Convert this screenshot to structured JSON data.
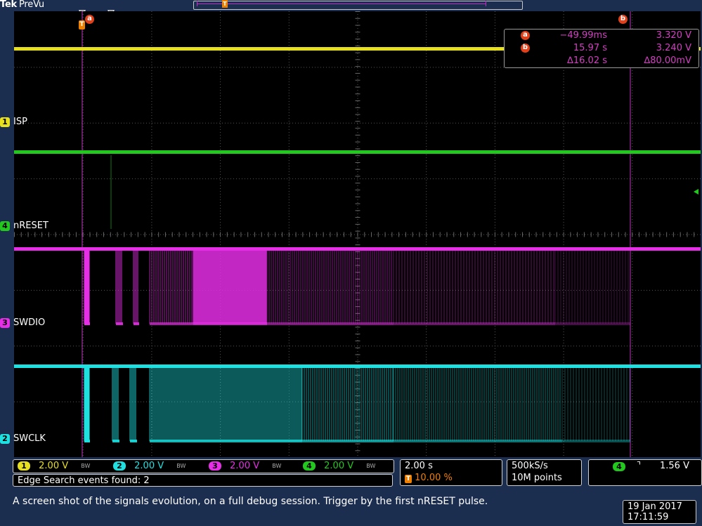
{
  "header": {
    "brand": "Tek",
    "mode": "PreVu"
  },
  "channels": [
    {
      "id": "1",
      "name": "ISP",
      "color": "#e6e01e"
    },
    {
      "id": "4",
      "name": "nRESET",
      "color": "#22c81e"
    },
    {
      "id": "3",
      "name": "SWDIO",
      "color": "#e62ee6"
    },
    {
      "id": "2",
      "name": "SWCLK",
      "color": "#1ee0e0"
    }
  ],
  "cursors": {
    "a_label": "a",
    "b_label": "b",
    "trigger_label": "T",
    "a_time": "−49.99ms",
    "a_value": "3.320 V",
    "b_time": "15.97 s",
    "b_value": "3.240 V",
    "delta_time": "∆16.02 s",
    "delta_value": "∆80.00mV"
  },
  "vertical_settings": [
    {
      "id": "1",
      "scale": "2.00 V",
      "bw": "BW",
      "color": "#e6e01e"
    },
    {
      "id": "2",
      "scale": "2.00 V",
      "bw": "BW",
      "color": "#1ee0e0"
    },
    {
      "id": "3",
      "scale": "2.00 V",
      "bw": "BW",
      "color": "#e62ee6"
    },
    {
      "id": "4",
      "scale": "2.00 V",
      "bw": "BW",
      "color": "#22c81e"
    }
  ],
  "horizontal": {
    "scale": "2.00 s",
    "trigger_position": "10.00 %"
  },
  "acquisition": {
    "rate": "500kS/s",
    "record": "10M points"
  },
  "trigger": {
    "source": "4",
    "slope": "⌝",
    "level": "1.56 V"
  },
  "search_status": "Edge Search events found: 2",
  "caption": "A screen shot of the signals evolution, on a full debug session. Trigger by the first nRESET pulse.",
  "datetime": {
    "date": "19 Jan  2017",
    "time": "17:11:59"
  }
}
